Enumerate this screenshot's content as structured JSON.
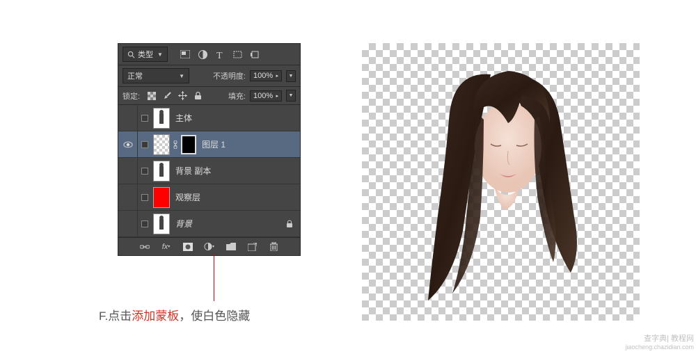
{
  "filter": {
    "label": "类型"
  },
  "blend": {
    "mode": "正常",
    "opacity_label": "不透明度:",
    "opacity_value": "100%"
  },
  "lock": {
    "label": "锁定:",
    "fill_label": "填充:",
    "fill_value": "100%"
  },
  "layers": [
    {
      "name": "主体",
      "thumb": "figure",
      "selected": false,
      "visible": false
    },
    {
      "name": "图层 1",
      "thumb": "checker",
      "mask": true,
      "selected": true,
      "visible": true
    },
    {
      "name": "背景 副本",
      "thumb": "figure",
      "selected": false,
      "visible": false
    },
    {
      "name": "观察层",
      "thumb": "red",
      "selected": false,
      "visible": false
    },
    {
      "name": "背景",
      "thumb": "figure",
      "italic": true,
      "locked": true,
      "selected": false,
      "visible": false
    }
  ],
  "callout": {
    "prefix": "F.点击",
    "highlight": "添加蒙板",
    "suffix": "，使白色隐藏"
  },
  "watermark": {
    "line1": "查字典| 教程网",
    "line2": "jiaocheng.chazidian.com"
  }
}
